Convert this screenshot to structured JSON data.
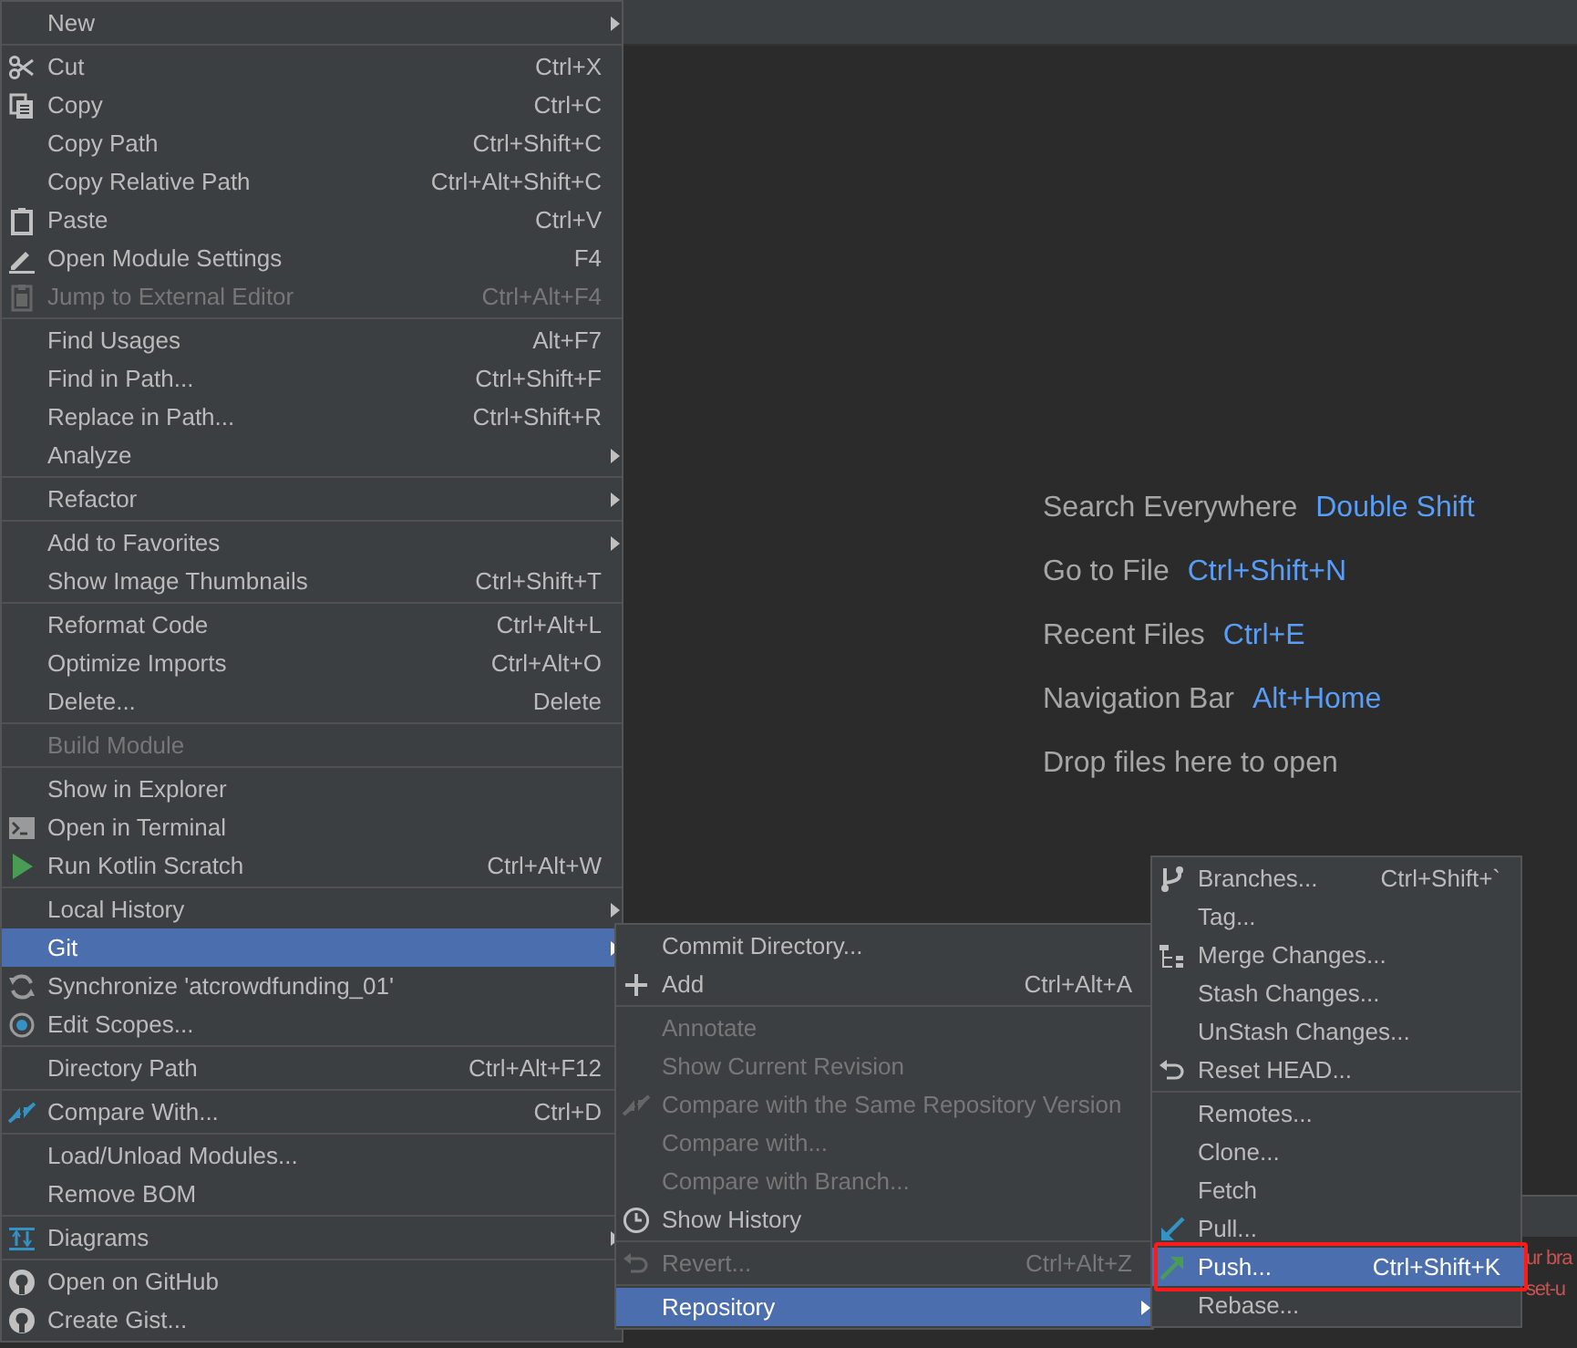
{
  "context_menu": {
    "groups": [
      [
        {
          "label": "New",
          "submenu": true,
          "disabled": false,
          "selected": false
        }
      ],
      [
        {
          "label": "Cut",
          "shortcut": "Ctrl+X",
          "submenu": false,
          "disabled": false,
          "selected": false
        },
        {
          "label": "Copy",
          "shortcut": "Ctrl+C",
          "submenu": false,
          "disabled": false,
          "selected": false
        },
        {
          "label": "Copy Path",
          "shortcut": "Ctrl+Shift+C",
          "submenu": false,
          "disabled": false,
          "selected": false
        },
        {
          "label": "Copy Relative Path",
          "shortcut": "Ctrl+Alt+Shift+C",
          "submenu": false,
          "disabled": false,
          "selected": false
        },
        {
          "label": "Paste",
          "shortcut": "Ctrl+V",
          "submenu": false,
          "disabled": false,
          "selected": false
        },
        {
          "label": "Open Module Settings",
          "shortcut": "F4",
          "submenu": false,
          "disabled": false,
          "selected": false
        },
        {
          "label": "Jump to External Editor",
          "shortcut": "Ctrl+Alt+F4",
          "submenu": false,
          "disabled": true,
          "selected": false
        }
      ],
      [
        {
          "label": "Find Usages",
          "shortcut": "Alt+F7",
          "submenu": false,
          "disabled": false,
          "selected": false
        },
        {
          "label": "Find in Path...",
          "shortcut": "Ctrl+Shift+F",
          "submenu": false,
          "disabled": false,
          "selected": false
        },
        {
          "label": "Replace in Path...",
          "shortcut": "Ctrl+Shift+R",
          "submenu": false,
          "disabled": false,
          "selected": false
        },
        {
          "label": "Analyze",
          "submenu": true,
          "disabled": false,
          "selected": false
        }
      ],
      [
        {
          "label": "Refactor",
          "submenu": true,
          "disabled": false,
          "selected": false
        }
      ],
      [
        {
          "label": "Add to Favorites",
          "submenu": true,
          "disabled": false,
          "selected": false
        },
        {
          "label": "Show Image Thumbnails",
          "shortcut": "Ctrl+Shift+T",
          "submenu": false,
          "disabled": false,
          "selected": false
        }
      ],
      [
        {
          "label": "Reformat Code",
          "shortcut": "Ctrl+Alt+L",
          "submenu": false,
          "disabled": false,
          "selected": false
        },
        {
          "label": "Optimize Imports",
          "shortcut": "Ctrl+Alt+O",
          "submenu": false,
          "disabled": false,
          "selected": false
        },
        {
          "label": "Delete...",
          "shortcut": "Delete",
          "submenu": false,
          "disabled": false,
          "selected": false
        }
      ],
      [
        {
          "label": "Build Module",
          "submenu": false,
          "disabled": true,
          "selected": false
        }
      ],
      [
        {
          "label": "Show in Explorer",
          "submenu": false,
          "disabled": false,
          "selected": false
        },
        {
          "label": "Open in Terminal",
          "submenu": false,
          "disabled": false,
          "selected": false
        },
        {
          "label": "Run Kotlin Scratch",
          "shortcut": "Ctrl+Alt+W",
          "submenu": false,
          "disabled": false,
          "selected": false
        }
      ],
      [
        {
          "label": "Local History",
          "submenu": true,
          "disabled": false,
          "selected": false
        },
        {
          "label": "Git",
          "submenu": true,
          "disabled": false,
          "selected": true
        },
        {
          "label": "Synchronize 'atcrowdfunding_01'",
          "submenu": false,
          "disabled": false,
          "selected": false
        },
        {
          "label": "Edit Scopes...",
          "submenu": false,
          "disabled": false,
          "selected": false
        }
      ],
      [
        {
          "label": "Directory Path",
          "shortcut": "Ctrl+Alt+F12",
          "submenu": false,
          "disabled": false,
          "selected": false
        }
      ],
      [
        {
          "label": "Compare With...",
          "shortcut": "Ctrl+D",
          "submenu": false,
          "disabled": false,
          "selected": false
        }
      ],
      [
        {
          "label": "Load/Unload Modules...",
          "submenu": false,
          "disabled": false,
          "selected": false
        },
        {
          "label": "Remove BOM",
          "submenu": false,
          "disabled": false,
          "selected": false
        }
      ],
      [
        {
          "label": "Diagrams",
          "submenu": true,
          "disabled": false,
          "selected": false
        }
      ],
      [
        {
          "label": "Open on GitHub",
          "submenu": false,
          "disabled": false,
          "selected": false
        },
        {
          "label": "Create Gist...",
          "submenu": false,
          "disabled": false,
          "selected": false
        }
      ]
    ]
  },
  "git_submenu": {
    "groups": [
      [
        {
          "label": "Commit Directory...",
          "submenu": false,
          "disabled": false,
          "selected": false
        },
        {
          "label": "Add",
          "shortcut": "Ctrl+Alt+A",
          "submenu": false,
          "disabled": false,
          "selected": false
        }
      ],
      [
        {
          "label": "Annotate",
          "submenu": false,
          "disabled": true,
          "selected": false
        },
        {
          "label": "Show Current Revision",
          "submenu": false,
          "disabled": true,
          "selected": false
        },
        {
          "label": "Compare with the Same Repository Version",
          "submenu": false,
          "disabled": true,
          "selected": false
        },
        {
          "label": "Compare with...",
          "submenu": false,
          "disabled": true,
          "selected": false
        },
        {
          "label": "Compare with Branch...",
          "submenu": false,
          "disabled": true,
          "selected": false
        },
        {
          "label": "Show History",
          "submenu": false,
          "disabled": false,
          "selected": false
        }
      ],
      [
        {
          "label": "Revert...",
          "shortcut": "Ctrl+Alt+Z",
          "submenu": false,
          "disabled": true,
          "selected": false
        }
      ],
      [
        {
          "label": "Repository",
          "submenu": true,
          "disabled": false,
          "selected": true
        }
      ]
    ]
  },
  "repository_submenu": {
    "groups": [
      [
        {
          "label": "Branches...",
          "shortcut": "Ctrl+Shift+`",
          "submenu": false,
          "disabled": false,
          "selected": false
        },
        {
          "label": "Tag...",
          "submenu": false,
          "disabled": false,
          "selected": false
        },
        {
          "label": "Merge Changes...",
          "submenu": false,
          "disabled": false,
          "selected": false
        },
        {
          "label": "Stash Changes...",
          "submenu": false,
          "disabled": false,
          "selected": false
        },
        {
          "label": "UnStash Changes...",
          "submenu": false,
          "disabled": false,
          "selected": false
        },
        {
          "label": "Reset HEAD...",
          "submenu": false,
          "disabled": false,
          "selected": false
        }
      ],
      [
        {
          "label": "Remotes...",
          "submenu": false,
          "disabled": false,
          "selected": false
        },
        {
          "label": "Clone...",
          "submenu": false,
          "disabled": false,
          "selected": false
        },
        {
          "label": "Fetch",
          "submenu": false,
          "disabled": false,
          "selected": false
        },
        {
          "label": "Pull...",
          "submenu": false,
          "disabled": false,
          "selected": false
        },
        {
          "label": "Push...",
          "shortcut": "Ctrl+Shift+K",
          "submenu": false,
          "disabled": false,
          "selected": true,
          "annotated": true
        },
        {
          "label": "Rebase...",
          "submenu": false,
          "disabled": false,
          "selected": false
        }
      ]
    ]
  },
  "editor_hints": [
    {
      "label": "Search Everywhere",
      "shortcut": "Double Shift"
    },
    {
      "label": "Go to File",
      "shortcut": "Ctrl+Shift+N"
    },
    {
      "label": "Recent Files",
      "shortcut": "Ctrl+E"
    },
    {
      "label": "Navigation Bar",
      "shortcut": "Alt+Home"
    },
    {
      "label": "Drop files here to open"
    }
  ],
  "console_panel": {
    "lines": [
      "ur bra",
      "set-u"
    ]
  }
}
